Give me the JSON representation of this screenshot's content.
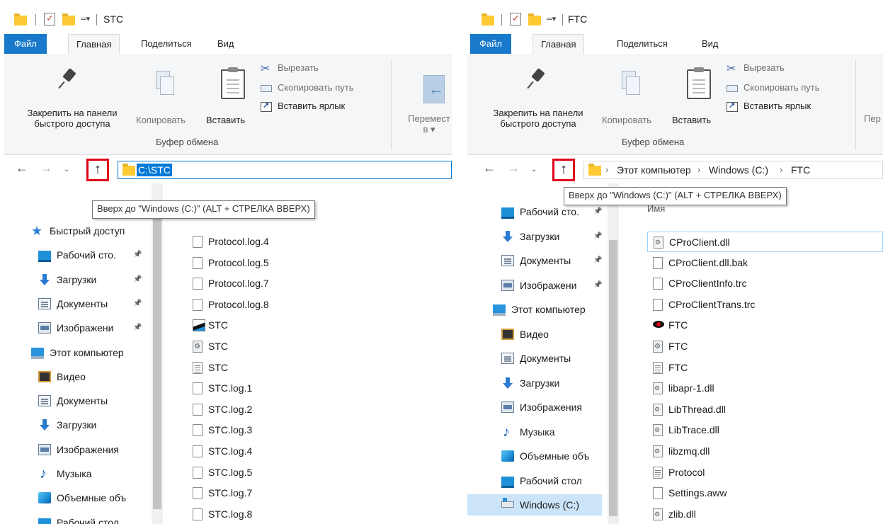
{
  "left_window": {
    "title": "STC",
    "tabs": {
      "file": "Файл",
      "home": "Главная",
      "share": "Поделиться",
      "view": "Вид"
    },
    "ribbon": {
      "pin_line1": "Закрепить на панели",
      "pin_line2": "быстрого доступа",
      "copy": "Копировать",
      "paste": "Вставить",
      "cut": "Вырезать",
      "copy_path": "Скопировать путь",
      "paste_shortcut": "Вставить ярлык",
      "move_line1": "Перемест",
      "move_line2": "в ▾",
      "clipboard_group": "Буфер обмена"
    },
    "address": "C:\\STC",
    "tooltip": "Вверх до \"Windows (C:)\" (ALT + СТРЕЛКА ВВЕРХ)",
    "nav": [
      {
        "label": "Быстрый доступ",
        "icon": "star-icon",
        "pinned": false
      },
      {
        "label": "Рабочий сто.",
        "icon": "desktop-icon",
        "pinned": true
      },
      {
        "label": "Загрузки",
        "icon": "downloads-icon",
        "pinned": true
      },
      {
        "label": "Документы",
        "icon": "documents-icon",
        "pinned": true
      },
      {
        "label": "Изображени",
        "icon": "images-icon",
        "pinned": true
      },
      {
        "label": "Этот компьютер",
        "icon": "computer-icon",
        "pinned": false
      },
      {
        "label": "Видео",
        "icon": "video-icon",
        "pinned": false
      },
      {
        "label": "Документы",
        "icon": "documents-icon",
        "pinned": false
      },
      {
        "label": "Загрузки",
        "icon": "downloads-icon",
        "pinned": false
      },
      {
        "label": "Изображения",
        "icon": "images-icon",
        "pinned": false
      },
      {
        "label": "Музыка",
        "icon": "music-icon",
        "pinned": false
      },
      {
        "label": "Объемные объ",
        "icon": "3d-objects-icon",
        "pinned": false
      },
      {
        "label": "Рабочий стол",
        "icon": "desktop-icon",
        "pinned": false
      }
    ],
    "files": [
      {
        "name": "Protocol.log.4",
        "icon": "blank"
      },
      {
        "name": "Protocol.log.5",
        "icon": "blank"
      },
      {
        "name": "Protocol.log.7",
        "icon": "blank"
      },
      {
        "name": "Protocol.log.8",
        "icon": "blank"
      },
      {
        "name": "STC",
        "icon": "stcapp"
      },
      {
        "name": "STC",
        "icon": "config"
      },
      {
        "name": "STC",
        "icon": "text"
      },
      {
        "name": "STC.log.1",
        "icon": "blank"
      },
      {
        "name": "STC.log.2",
        "icon": "blank"
      },
      {
        "name": "STC.log.3",
        "icon": "blank"
      },
      {
        "name": "STC.log.4",
        "icon": "blank"
      },
      {
        "name": "STC.log.5",
        "icon": "blank"
      },
      {
        "name": "STC.log.7",
        "icon": "blank"
      },
      {
        "name": "STC.log.8",
        "icon": "blank"
      }
    ]
  },
  "right_window": {
    "title": "FTC",
    "tabs": {
      "file": "Файл",
      "home": "Главная",
      "share": "Поделиться",
      "view": "Вид"
    },
    "ribbon": {
      "pin_line1": "Закрепить на панели",
      "pin_line2": "быстрого доступа",
      "copy": "Копировать",
      "paste": "Вставить",
      "cut": "Вырезать",
      "copy_path": "Скопировать путь",
      "paste_shortcut": "Вставить ярлык",
      "move_partial": "Пер",
      "clipboard_group": "Буфер обмена"
    },
    "breadcrumbs": [
      "Этот компьютер",
      "Windows (C:)",
      "FTC"
    ],
    "tooltip": "Вверх до \"Windows (C:)\" (ALT + СТРЕЛКА ВВЕРХ)",
    "column_header": "Имя",
    "nav": [
      {
        "label": "Рабочий сто.",
        "icon": "desktop-icon",
        "pinned": true
      },
      {
        "label": "Загрузки",
        "icon": "downloads-icon",
        "pinned": true
      },
      {
        "label": "Документы",
        "icon": "documents-icon",
        "pinned": true
      },
      {
        "label": "Изображени",
        "icon": "images-icon",
        "pinned": true
      },
      {
        "label": "Этот компьютер",
        "icon": "computer-icon",
        "pinned": false
      },
      {
        "label": "Видео",
        "icon": "video-icon",
        "pinned": false
      },
      {
        "label": "Документы",
        "icon": "documents-icon",
        "pinned": false
      },
      {
        "label": "Загрузки",
        "icon": "downloads-icon",
        "pinned": false
      },
      {
        "label": "Изображения",
        "icon": "images-icon",
        "pinned": false
      },
      {
        "label": "Музыка",
        "icon": "music-icon",
        "pinned": false
      },
      {
        "label": "Объемные объ",
        "icon": "3d-objects-icon",
        "pinned": false
      },
      {
        "label": "Рабочий стол",
        "icon": "desktop-icon",
        "pinned": false
      },
      {
        "label": "Windows (C:)",
        "icon": "drive-icon",
        "pinned": false,
        "selected": true
      }
    ],
    "files": [
      {
        "name": "CProClient.dll",
        "icon": "dll",
        "selected": true
      },
      {
        "name": "CProClient.dll.bak",
        "icon": "blank"
      },
      {
        "name": "CProClientInfo.trc",
        "icon": "blank"
      },
      {
        "name": "CProClientTrans.trc",
        "icon": "blank"
      },
      {
        "name": "FTC",
        "icon": "ftcapp"
      },
      {
        "name": "FTC",
        "icon": "config"
      },
      {
        "name": "FTC",
        "icon": "text"
      },
      {
        "name": "libapr-1.dll",
        "icon": "dll"
      },
      {
        "name": "LibThread.dll",
        "icon": "dll"
      },
      {
        "name": "LibTrace.dll",
        "icon": "dll"
      },
      {
        "name": "libzmq.dll",
        "icon": "dll"
      },
      {
        "name": "Protocol",
        "icon": "text"
      },
      {
        "name": "Settings.aww",
        "icon": "blank"
      },
      {
        "name": "zlib.dll",
        "icon": "dll"
      }
    ]
  },
  "colors": {
    "accent": "#1979ca",
    "highlight_box": "#e2001a",
    "selection": "#0078d7"
  }
}
